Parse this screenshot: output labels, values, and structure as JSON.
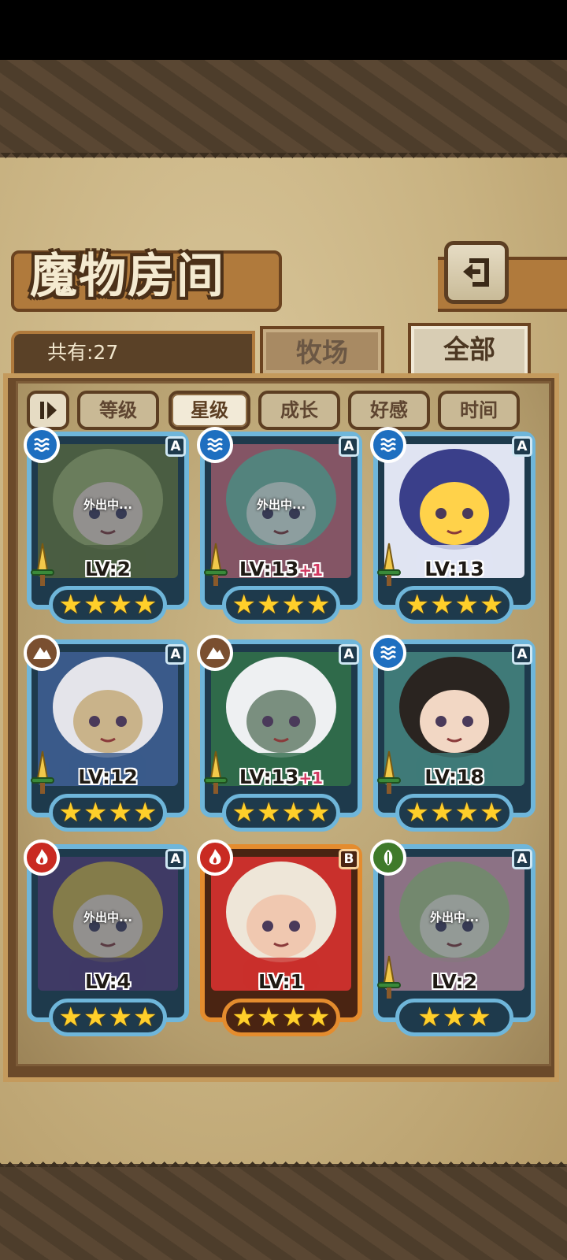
{
  "header": {
    "title": "魔物房间",
    "back_icon": "back-arrow-icon"
  },
  "summary": {
    "count_label": "共有:27"
  },
  "tabs": [
    {
      "label": "牧场",
      "active": false
    },
    {
      "label": "全部",
      "active": true
    }
  ],
  "sort": {
    "toggle_icon": "sort-order-icon",
    "filters": [
      {
        "label": "等级",
        "active": false
      },
      {
        "label": "星级",
        "active": true
      },
      {
        "label": "成长",
        "active": false
      },
      {
        "label": "好感",
        "active": false
      },
      {
        "label": "时间",
        "active": false
      }
    ]
  },
  "colors": {
    "water": "#1e6fc0",
    "earth": "#7a4f30",
    "fire": "#c92a22",
    "nature": "#3f7a2a",
    "card_frame": "#6fb6da",
    "card_frame_gold": "#e48c2e",
    "star": "#ffcf2a"
  },
  "monsters": [
    {
      "element": "water",
      "rank": "A",
      "level": "LV:2",
      "bonus": "",
      "stars": 4,
      "status": "外出中...",
      "weapon": true,
      "frame": "blue"
    },
    {
      "element": "water",
      "rank": "A",
      "level": "LV:13",
      "bonus": "+1",
      "stars": 4,
      "status": "外出中...",
      "weapon": true,
      "frame": "blue"
    },
    {
      "element": "water",
      "rank": "A",
      "level": "LV:13",
      "bonus": "",
      "stars": 4,
      "status": "",
      "weapon": true,
      "frame": "blue"
    },
    {
      "element": "earth",
      "rank": "A",
      "level": "LV:12",
      "bonus": "",
      "stars": 4,
      "status": "",
      "weapon": true,
      "frame": "blue"
    },
    {
      "element": "earth",
      "rank": "A",
      "level": "LV:13",
      "bonus": "+1",
      "stars": 4,
      "status": "",
      "weapon": true,
      "frame": "blue"
    },
    {
      "element": "water",
      "rank": "A",
      "level": "LV:18",
      "bonus": "",
      "stars": 4,
      "status": "",
      "weapon": true,
      "frame": "blue"
    },
    {
      "element": "fire",
      "rank": "A",
      "level": "LV:4",
      "bonus": "",
      "stars": 4,
      "status": "外出中...",
      "weapon": false,
      "frame": "blue"
    },
    {
      "element": "fire",
      "rank": "B",
      "level": "LV:1",
      "bonus": "",
      "stars": 4,
      "status": "",
      "weapon": false,
      "frame": "gold"
    },
    {
      "element": "nature",
      "rank": "A",
      "level": "LV:2",
      "bonus": "",
      "stars": 3,
      "status": "外出中...",
      "weapon": true,
      "frame": "blue"
    }
  ]
}
